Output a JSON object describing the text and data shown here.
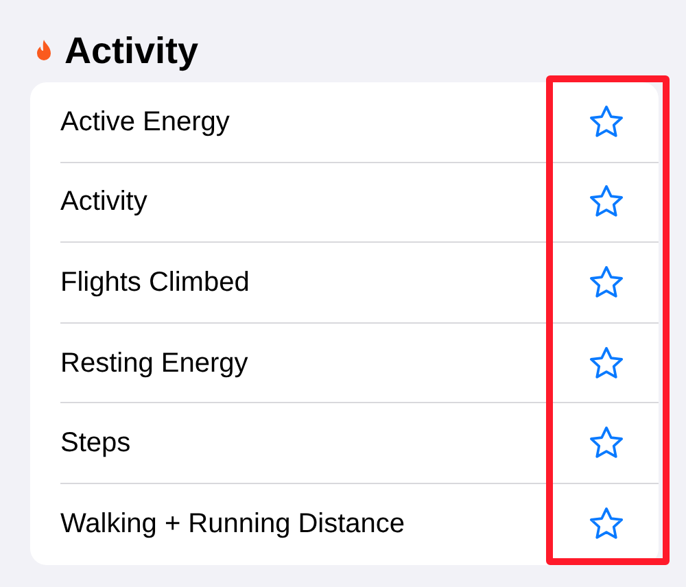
{
  "section": {
    "title": "Activity"
  },
  "items": [
    {
      "label": "Active Energy",
      "favorite": false
    },
    {
      "label": "Activity",
      "favorite": false
    },
    {
      "label": "Flights Climbed",
      "favorite": false
    },
    {
      "label": "Resting Energy",
      "favorite": false
    },
    {
      "label": "Steps",
      "favorite": false
    },
    {
      "label": "Walking + Running Distance",
      "favorite": false
    }
  ]
}
